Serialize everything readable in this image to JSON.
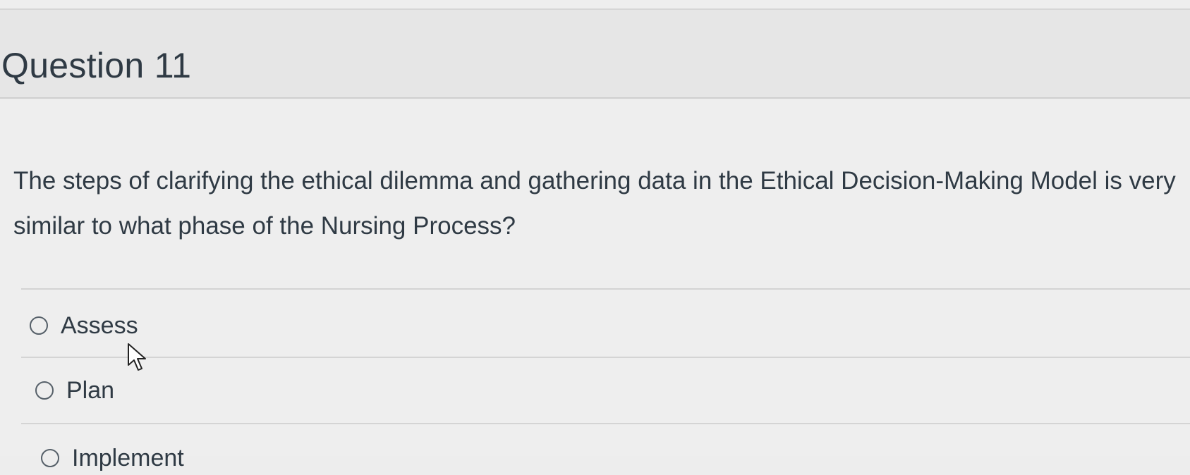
{
  "question": {
    "title": "Question 11",
    "text": "The steps of clarifying the ethical dilemma and gathering data in the Ethical Decision-Making Model is very similar to what phase of the Nursing Process?"
  },
  "answers": [
    {
      "label": "Assess"
    },
    {
      "label": "Plan"
    },
    {
      "label": "Implement"
    }
  ],
  "colors": {
    "background": "#eeeeee",
    "header_background": "#e6e6e6",
    "text": "#2f3a44",
    "divider": "#d4d4d4"
  },
  "icons": {
    "radio": "radio-button-icon",
    "cursor": "mouse-pointer-icon"
  }
}
